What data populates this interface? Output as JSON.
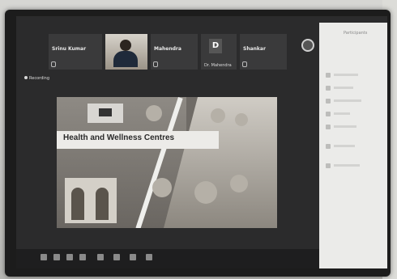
{
  "meeting": {
    "recording_label": "Recording",
    "participants": [
      {
        "name": "Srinu Kumar",
        "type": "name-tile"
      },
      {
        "name": "",
        "type": "video"
      },
      {
        "name": "Mahendra",
        "type": "name-tile"
      },
      {
        "name": "D",
        "sub": "Dr. Mahendra",
        "type": "avatar"
      },
      {
        "name": "Shankar",
        "type": "name-tile"
      }
    ]
  },
  "slide": {
    "title": "Health and Wellness Centres"
  },
  "panel": {
    "header": "Participants"
  },
  "icons": [
    "mic-icon",
    "video-icon",
    "share-icon",
    "chat-icon",
    "leave-icon"
  ]
}
